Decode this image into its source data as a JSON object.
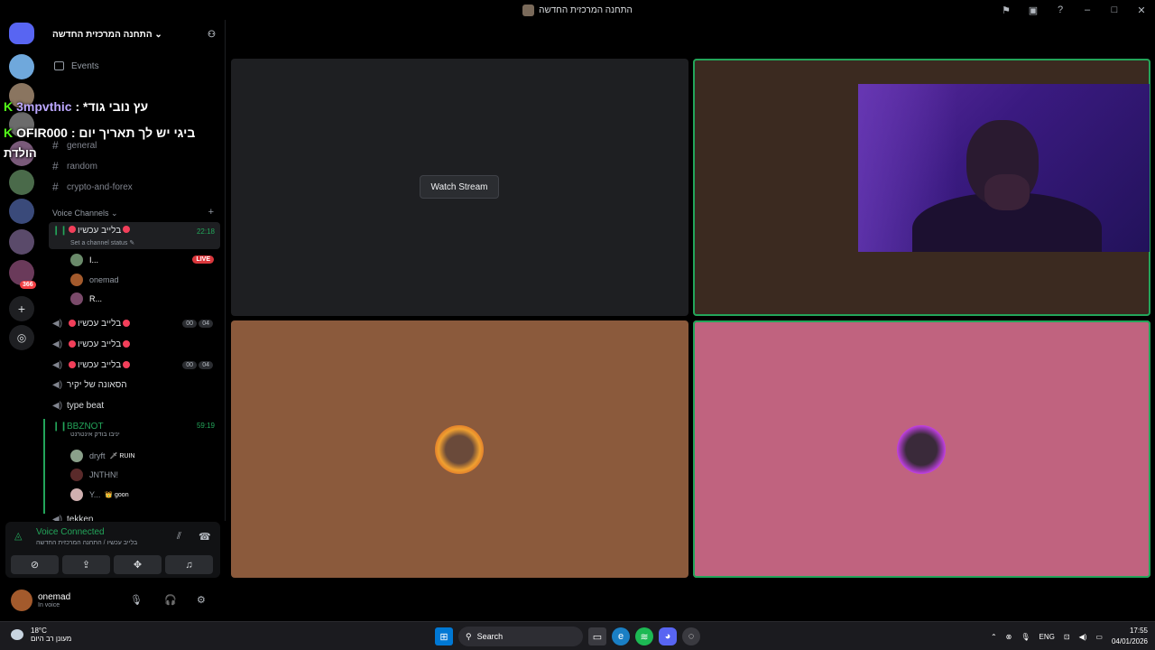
{
  "window": {
    "title": "התחנה המרכזית החדשה"
  },
  "server": {
    "name": "התחנה המרכזית החדשה ⌄"
  },
  "sidebar": {
    "events": "Events",
    "text_channels": [
      "general",
      "random",
      "crypto-and-forex"
    ],
    "voice_category": "Voice Channels ⌄",
    "voice_channels": [
      {
        "name": "בלייב עכשיו",
        "time": "22:18",
        "status": "Set a channel status ✎"
      },
      {
        "name": "בלייב עכשיו",
        "c1": "00",
        "c2": "04"
      },
      {
        "name": "בלייב עכשיו"
      },
      {
        "name": "בלייב עכשיו",
        "c1": "00",
        "c2": "04"
      },
      {
        "name": "הסאונה של יקיר"
      },
      {
        "name": "type beat"
      },
      {
        "name": "BBZNOT",
        "time": "59:19",
        "status": "יניבו בודק אינטרנט"
      },
      {
        "name": "tekken"
      }
    ],
    "members_live": [
      {
        "name": "I...",
        "badge": "LIVE"
      },
      {
        "name": "onemad"
      },
      {
        "name": "R..."
      }
    ],
    "members_bbz": [
      {
        "name": "dryft",
        "tag": "🗡 RUIN"
      },
      {
        "name": "JNTHN!"
      },
      {
        "name": "Y...",
        "tag": "👑 goon"
      }
    ]
  },
  "overlay_chat": [
    {
      "user": "3mpvthic",
      "msg": "*עץ נובי גוד"
    },
    {
      "user": "OFIR000",
      "msg": "ביגי יש לך תאריך יום"
    },
    {
      "user": "",
      "msg": "הולדת"
    }
  ],
  "voice_panel": {
    "status": "Voice Connected",
    "channel": "בלייב עכשיו / התחנה המרכזית החדשה"
  },
  "user_panel": {
    "name": "onemad",
    "status": "In voice"
  },
  "stage": {
    "watch_stream": "Watch Stream",
    "tile_colors": [
      "#1e1f22",
      "#3b2a20",
      "#8b5a3c",
      "#c0637f"
    ]
  },
  "rail": {
    "badge": "366"
  },
  "taskbar": {
    "temp": "18°C",
    "weather": "מעונן רב היום",
    "search": "Search",
    "lang": "ENG",
    "time": "17:55",
    "date": "04/01/2026"
  }
}
